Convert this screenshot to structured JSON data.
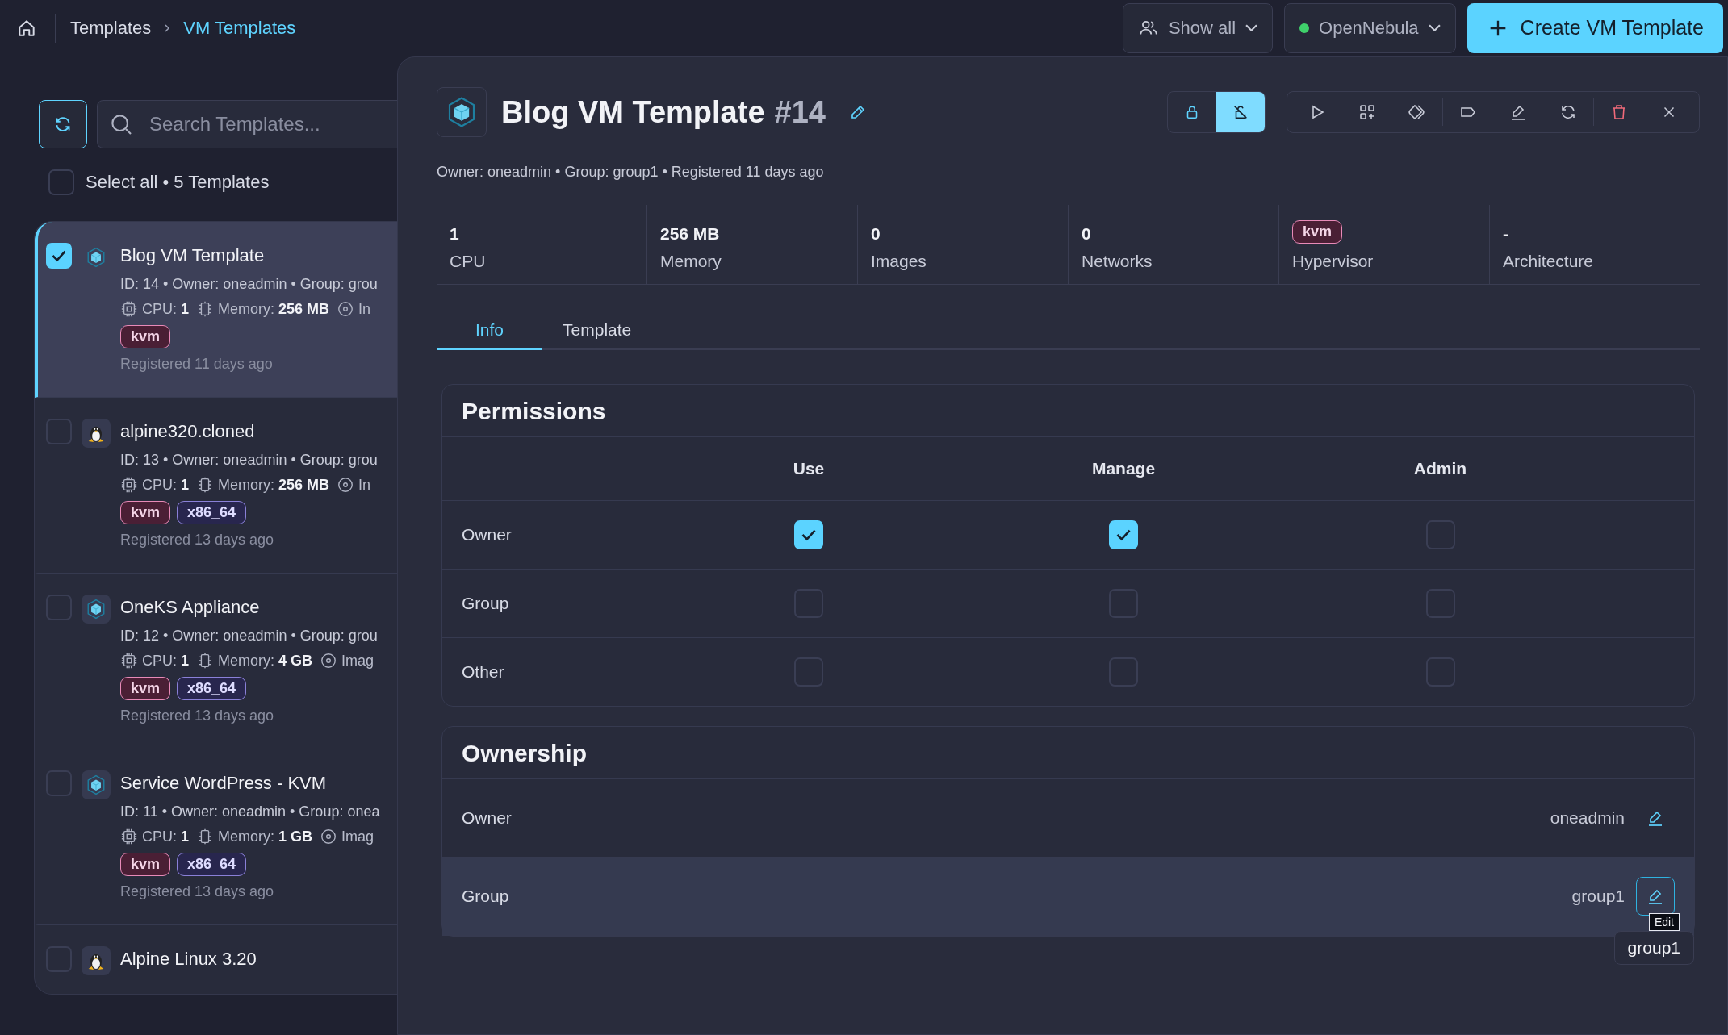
{
  "breadcrumb": [
    {
      "label": "Templates",
      "selected": false
    },
    {
      "label": "VM Templates",
      "selected": true
    }
  ],
  "top_actions": {
    "filter": "Show all",
    "zone": "OpenNebula",
    "create": "Create VM Template"
  },
  "sidebar": {
    "search": {
      "placeholder": "Search Templates..."
    },
    "select_all": {
      "label": "Select all • 5 Templates",
      "checked": false
    },
    "items": [
      {
        "name": "Blog VM Template",
        "kind": "cube",
        "checked": true,
        "selected": true,
        "meta": "ID: 14 • Owner: oneadmin • Group: grou",
        "cpu_label": "CPU:",
        "cpu": "1",
        "memory_label": "Memory:",
        "memory": "256 MB",
        "images_label": "In",
        "tags": [
          {
            "label": "kvm",
            "kind": "hypervisor"
          }
        ],
        "registered": "Registered 11 days ago"
      },
      {
        "name": "alpine320.cloned",
        "kind": "penguin",
        "checked": false,
        "selected": false,
        "meta": "ID: 13 • Owner: oneadmin • Group: grou",
        "cpu_label": "CPU:",
        "cpu": "1",
        "memory_label": "Memory:",
        "memory": "256 MB",
        "images_label": "In",
        "tags": [
          {
            "label": "kvm",
            "kind": "hypervisor"
          },
          {
            "label": "x86_64",
            "kind": "arch"
          }
        ],
        "registered": "Registered 13 days ago"
      },
      {
        "name": "OneKS Appliance",
        "kind": "cube",
        "checked": false,
        "selected": false,
        "meta": "ID: 12 • Owner: oneadmin • Group: grou",
        "cpu_label": "CPU:",
        "cpu": "1",
        "memory_label": "Memory:",
        "memory": "4 GB",
        "images_label": "Imag",
        "tags": [
          {
            "label": "kvm",
            "kind": "hypervisor"
          },
          {
            "label": "x86_64",
            "kind": "arch"
          }
        ],
        "registered": "Registered 13 days ago"
      },
      {
        "name": "Service WordPress - KVM",
        "kind": "cube",
        "checked": false,
        "selected": false,
        "meta": "ID: 11 • Owner: oneadmin • Group: onea",
        "cpu_label": "CPU:",
        "cpu": "1",
        "memory_label": "Memory:",
        "memory": "1 GB",
        "images_label": "Imag",
        "tags": [
          {
            "label": "kvm",
            "kind": "hypervisor"
          },
          {
            "label": "x86_64",
            "kind": "arch"
          }
        ],
        "registered": "Registered 13 days ago"
      },
      {
        "name": "Alpine Linux 3.20",
        "kind": "penguin",
        "checked": false,
        "selected": false
      }
    ]
  },
  "detail": {
    "title": "Blog VM Template",
    "id": "#14",
    "meta": "Owner: oneadmin • Group: group1 • Registered 11 days ago",
    "lock_toggle": [
      {
        "selected": false
      },
      {
        "selected": true
      }
    ],
    "stats": [
      {
        "value": "1",
        "label": "CPU"
      },
      {
        "value": "256 MB",
        "label": "Memory"
      },
      {
        "value": "0",
        "label": "Images"
      },
      {
        "value": "0",
        "label": "Networks"
      },
      {
        "tag": "kvm",
        "label": "Hypervisor"
      },
      {
        "value": "-",
        "label": "Architecture"
      }
    ],
    "tabs": [
      {
        "label": "Info",
        "selected": true
      },
      {
        "label": "Template",
        "selected": false
      }
    ],
    "permissions": {
      "title": "Permissions",
      "columns": [
        "Use",
        "Manage",
        "Admin"
      ],
      "rows": [
        {
          "label": "Owner",
          "checks": [
            {
              "checked": true
            },
            {
              "checked": true
            },
            {
              "checked": false
            }
          ]
        },
        {
          "label": "Group",
          "checks": [
            {
              "checked": false
            },
            {
              "checked": false
            },
            {
              "checked": false
            }
          ]
        },
        {
          "label": "Other",
          "checks": [
            {
              "checked": false
            },
            {
              "checked": false
            },
            {
              "checked": false
            }
          ]
        }
      ]
    },
    "ownership": {
      "title": "Ownership",
      "rows": [
        {
          "label": "Owner",
          "value": "oneadmin",
          "highlighted": false
        },
        {
          "label": "Group",
          "value": "group1",
          "highlighted": true
        }
      ]
    },
    "tooltip": "Edit",
    "popover": "group1"
  }
}
